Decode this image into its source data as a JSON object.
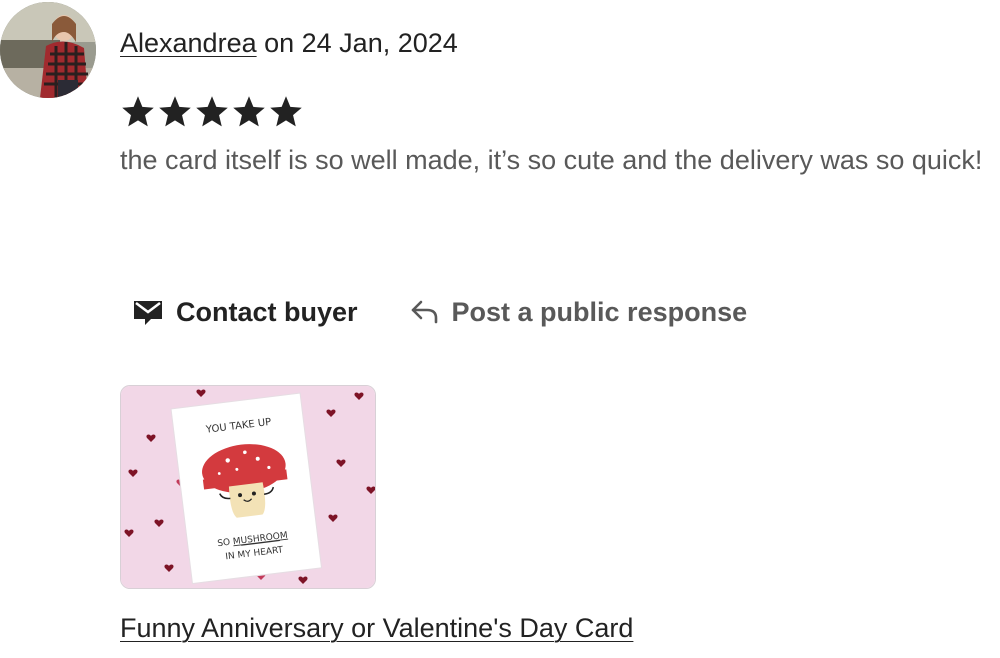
{
  "review": {
    "reviewer_name": "Alexandrea",
    "date_text": " on 24 Jan, 2024",
    "rating": 5,
    "rating_max": 5,
    "text": "the card itself is so well made, it’s so cute and the delivery was so quick!"
  },
  "actions": {
    "contact_label": "Contact buyer",
    "contact_icon": "envelope-icon",
    "respond_label": "Post a public response",
    "respond_icon": "reply-arrow-icon"
  },
  "product_photo": {
    "card_line1": "YOU TAKE UP",
    "card_line2_prefix": "SO ",
    "card_line2_emph": "MUSHROOM",
    "card_line3": "IN MY HEART"
  },
  "product": {
    "title": "Funny Anniversary or Valentine's Day Card"
  },
  "colors": {
    "star": "#222222",
    "text_primary": "#222222",
    "text_secondary": "#595959",
    "photo_background": "#f2d7e7",
    "mushroom_cap": "#d33a3e"
  }
}
